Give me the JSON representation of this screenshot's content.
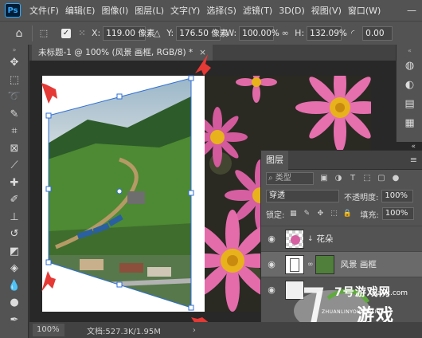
{
  "app": {
    "logo": "Ps"
  },
  "menu": [
    "文件(F)",
    "编辑(E)",
    "图像(I)",
    "图层(L)",
    "文字(Y)",
    "选择(S)",
    "滤镜(T)",
    "3D(D)",
    "视图(V)",
    "窗口(W)"
  ],
  "options": {
    "x_label": "X:",
    "x_value": "119.00 像素",
    "y_label": "Y:",
    "y_value": "176.50 像素",
    "w_label": "W:",
    "w_value": "100.00%",
    "h_label": "H:",
    "h_value": "132.09%",
    "angle_value": "0.00"
  },
  "document": {
    "tab_title": "未标题-1 @ 100% (风景 画框, RGB/8) *",
    "close": "×"
  },
  "status": {
    "zoom": "100%",
    "doc_info": "文档:527.3K/1.95M",
    "arrow": "›"
  },
  "layers_panel": {
    "title": "图层",
    "filter_placeholder": "类型",
    "blend_mode": "穿透",
    "opacity_label": "不透明度:",
    "opacity_value": "100%",
    "lock_label": "锁定:",
    "fill_label": "填充:",
    "fill_value": "100%",
    "layers": [
      {
        "name": "花朵",
        "selected": false
      },
      {
        "name": "风景 画框",
        "selected": true
      },
      {
        "name": "",
        "selected": false
      }
    ]
  },
  "watermark": {
    "brand": "7号游戏网",
    "url": "xiayx.com",
    "sub": "ZHUANLINYOUXIWANG",
    "tag": "游戏"
  },
  "colors": {
    "ui_bg": "#535353",
    "workspace": "#282828",
    "accent": "#31a8ff",
    "annotation": "#e53935",
    "selection": "#2f6fd6"
  }
}
